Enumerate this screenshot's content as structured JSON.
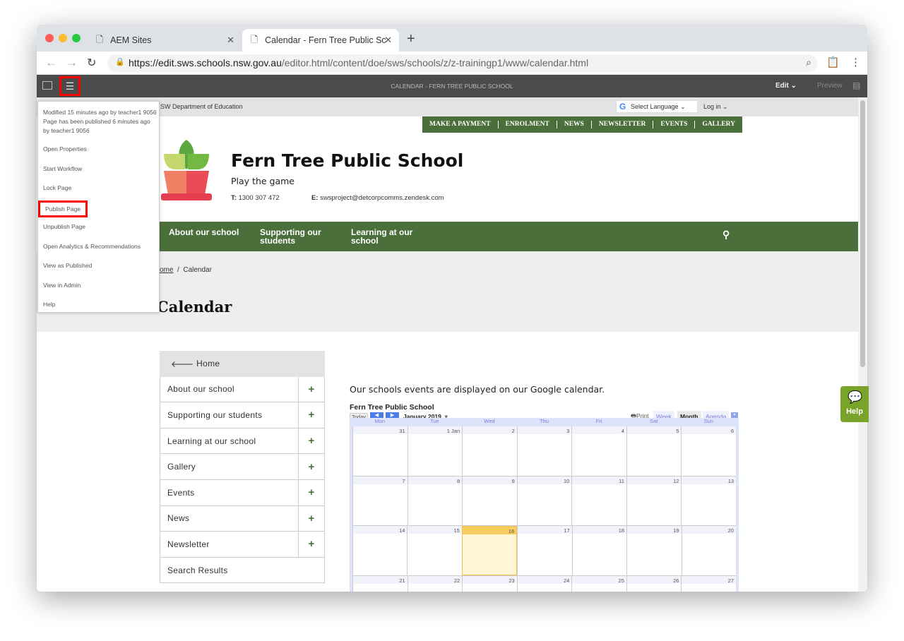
{
  "browser": {
    "tabs": [
      {
        "label": "AEM Sites"
      },
      {
        "label": "Calendar - Fern Tree Public Sc"
      }
    ],
    "url_host": "https://edit.sws.schools.nsw.gov.au",
    "url_path": "/editor.html/content/doe/sws/schools/z/z-trainingp1/www/calendar.html"
  },
  "aem": {
    "title": "CALENDAR - FERN TREE PUBLIC SCHOOL",
    "mode": "Edit",
    "preview": "Preview"
  },
  "menu": {
    "meta": "Modified 15 minutes ago by teacher1 9056 Page has been published 6 minutes ago by teacher1 9056",
    "items": [
      "Open Properties",
      "Start Workflow",
      "Lock Page",
      "Publish Page",
      "Unpublish Page",
      "Open Analytics & Recommendations",
      "View as Published",
      "View in Admin",
      "Help"
    ]
  },
  "site": {
    "dept": "SW Department of Education",
    "language": "Select Language",
    "login": "Log in",
    "utility": [
      "MAKE A PAYMENT",
      "ENROLMENT",
      "NEWS",
      "NEWSLETTER",
      "EVENTS",
      "GALLERY"
    ],
    "name": "Fern Tree Public School",
    "tagline": "Play the game",
    "phone_label": "T:",
    "phone": "1300 307 472",
    "email_label": "E:",
    "email": "swsproject@detcorpcomms.zendesk.com",
    "nav": [
      "About our school",
      "Supporting our students",
      "Learning at our school"
    ],
    "breadcrumb": [
      "ome",
      "Calendar"
    ],
    "title": "Calendar",
    "side": {
      "home": "Home",
      "items": [
        "About our school",
        "Supporting our students",
        "Learning at our school",
        "Gallery",
        "Events",
        "News",
        "Newsletter"
      ],
      "last": "Search Results"
    },
    "intro": "Our schools events are displayed on our Google calendar.",
    "help": "Help"
  },
  "calendar": {
    "title": "Fern Tree Public School",
    "today": "Today",
    "month": "January 2019",
    "print": "Print",
    "views": [
      "Week",
      "Month",
      "Agenda"
    ],
    "days": [
      "Mon",
      "Tue",
      "Wed",
      "Thu",
      "Fri",
      "Sat",
      "Sun"
    ],
    "weeks": [
      [
        "31",
        "1 Jan",
        "2",
        "3",
        "4",
        "5",
        "6"
      ],
      [
        "7",
        "8",
        "9",
        "10",
        "11",
        "12",
        "13"
      ],
      [
        "14",
        "15",
        "16",
        "17",
        "18",
        "19",
        "20"
      ],
      [
        "21",
        "22",
        "23",
        "24",
        "25",
        "26",
        "27"
      ]
    ],
    "highlighted_day": "16"
  },
  "colors": {
    "brand_green": "#4a6f3b",
    "help_green": "#7aa32a",
    "highlight": "#ff0000"
  }
}
